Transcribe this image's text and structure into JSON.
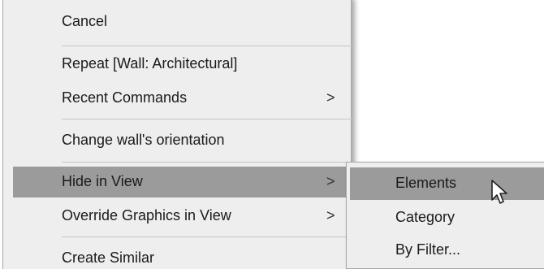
{
  "context_menu": {
    "items": [
      {
        "label": "Cancel",
        "has_submenu": false,
        "highlighted": false
      },
      {
        "label": "Repeat [Wall: Architectural]",
        "has_submenu": false,
        "highlighted": false
      },
      {
        "label": "Recent Commands",
        "has_submenu": true,
        "highlighted": false
      },
      {
        "label": "Change wall's orientation",
        "has_submenu": false,
        "highlighted": false
      },
      {
        "label": "Hide in View",
        "has_submenu": true,
        "highlighted": true
      },
      {
        "label": "Override Graphics in View",
        "has_submenu": true,
        "highlighted": false
      },
      {
        "label": "Create Similar",
        "has_submenu": false,
        "highlighted": false
      }
    ],
    "submenu_arrow": ">"
  },
  "submenu": {
    "parent": "Hide in View",
    "items": [
      {
        "label": "Elements",
        "highlighted": true
      },
      {
        "label": "Category",
        "highlighted": false
      },
      {
        "label": "By Filter...",
        "highlighted": false
      }
    ]
  },
  "colors": {
    "menu_bg": "#eeeeee",
    "highlight": "#9b9b9b",
    "separator": "#c4c4c4"
  },
  "icons": {
    "cursor": "mouse-pointer-icon",
    "submenu": "chevron-right-icon"
  }
}
